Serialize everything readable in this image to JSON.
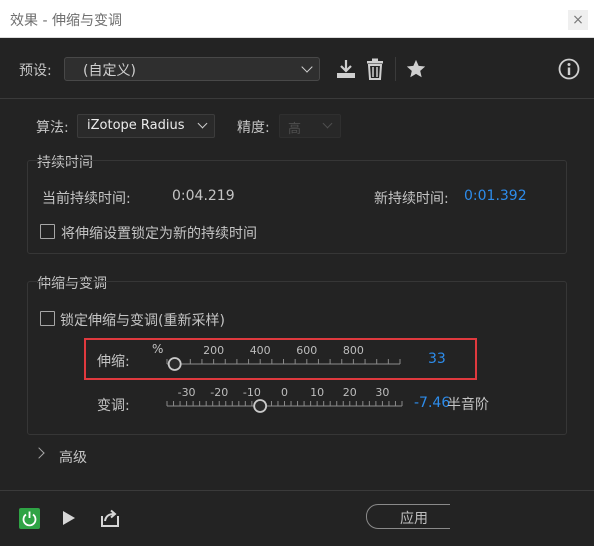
{
  "window": {
    "title": "效果 - 伸缩与变调",
    "close_label": "×"
  },
  "preset": {
    "label": "预设:",
    "value": "(自定义)"
  },
  "toolbar": {
    "save_icon": "download-icon",
    "delete_icon": "trash-icon",
    "favorite_icon": "star-icon",
    "info_icon": "info-icon"
  },
  "algorithm": {
    "label": "算法:",
    "value": "iZotope Radius",
    "precision_label": "精度:",
    "precision_value": "高"
  },
  "duration": {
    "group_title": "持续时间",
    "current_label": "当前持续时间:",
    "current_value": "0:04.219",
    "new_label": "新持续时间:",
    "new_value": "0:01.392",
    "lock_label": "将伸缩设置锁定为新的持续时间",
    "lock_checked": false
  },
  "stretch_pitch": {
    "group_title": "伸缩与变调",
    "lock_label": "锁定伸缩与变调(重新采样)",
    "lock_checked": false,
    "stretch": {
      "label": "伸缩:",
      "unit": "%",
      "ticks": [
        "200",
        "400",
        "600",
        "800"
      ],
      "value": "33",
      "min": 0,
      "max": 1000,
      "level": 33
    },
    "pitch": {
      "label": "变调:",
      "ticks": [
        "-30",
        "-20",
        "-10",
        "0",
        "10",
        "20",
        "30"
      ],
      "value": "-7.46",
      "unit": "半音阶",
      "min": -36,
      "max": 36,
      "level": -7.46
    }
  },
  "advanced": {
    "label": "高级",
    "expanded": false
  },
  "footer": {
    "power_icon": "power-icon",
    "play_icon": "play-icon",
    "export_icon": "export-icon",
    "apply_label": "应用"
  },
  "colors": {
    "accent": "#2d8ceb",
    "power": "#2fa345",
    "highlight": "#e0393e"
  }
}
